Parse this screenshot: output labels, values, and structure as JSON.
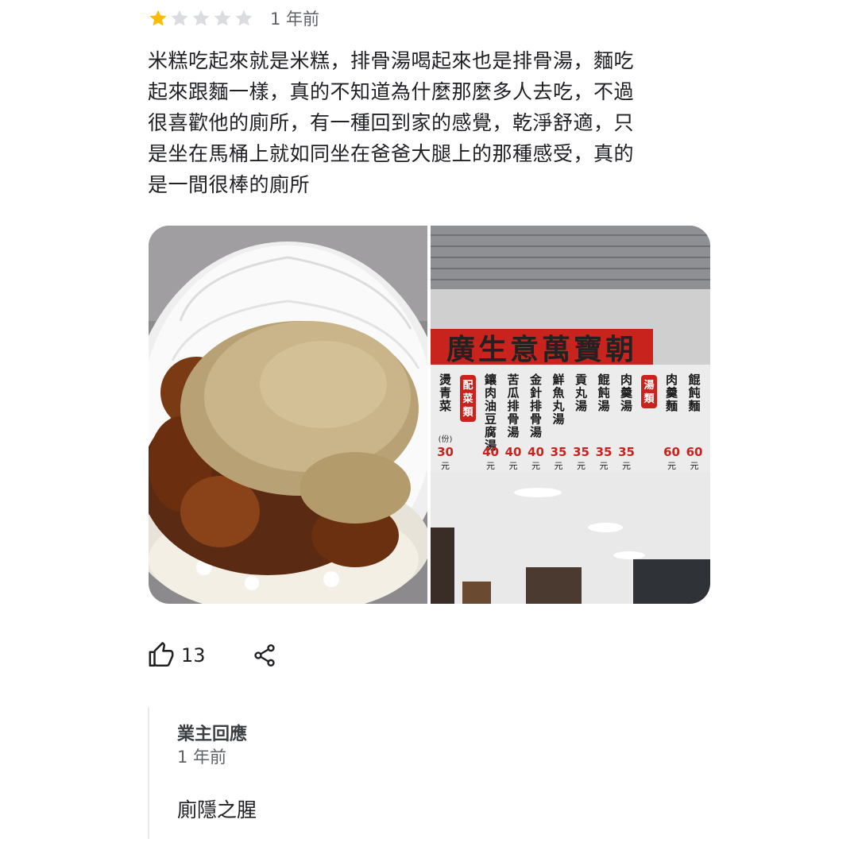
{
  "review": {
    "rating": 1,
    "max_rating": 5,
    "colors": {
      "star_filled": "#fbbc04",
      "star_empty": "#dadce0"
    },
    "time_ago": "1 年前",
    "text": "米糕吃起來就是米糕，排骨湯喝起來也是排骨湯，麵吃\n起來跟麵一樣，真的不知道為什麼那麼多人去吃，不過\n很喜歡他的廁所，有一種回到家的感覺，乾淨舒適，只\n是坐在馬桶上就如同坐在爸爸大腿上的那種感受，真的\n是一間很棒的廁所",
    "photos": [
      {
        "icon": "rice-cake-photo"
      },
      {
        "icon": "menu-board-photo",
        "sign_text": "廣生意萬寶朝",
        "menu": [
          {
            "name": "餛飩麵",
            "price": "60",
            "unit": "元"
          },
          {
            "name": "肉羹麵",
            "price": "60",
            "unit": "元"
          },
          {
            "name": "湯類"
          },
          {
            "name": "肉羹湯",
            "price": "35",
            "unit": "元"
          },
          {
            "name": "餛飩湯",
            "price": "35",
            "unit": "元"
          },
          {
            "name": "貢丸湯",
            "price": "35",
            "unit": "元"
          },
          {
            "name": "鮮魚丸湯",
            "price": "35",
            "unit": "元"
          },
          {
            "name": "金針排骨湯",
            "price": "40",
            "unit": "元"
          },
          {
            "name": "苦瓜排骨湯",
            "price": "40",
            "unit": "元"
          },
          {
            "name": "鑲肉油豆腐湯",
            "price": "40",
            "unit": "元"
          },
          {
            "name": "配菜類"
          },
          {
            "name": "燙青菜",
            "price": "30",
            "unit": "元",
            "note": "(份)"
          }
        ]
      }
    ],
    "likes": "13",
    "icons": {
      "like": "thumbs-up-icon",
      "share": "share-icon"
    }
  },
  "owner_reply": {
    "title": "業主回應",
    "time_ago": "1 年前",
    "text": "廁隱之腥"
  }
}
